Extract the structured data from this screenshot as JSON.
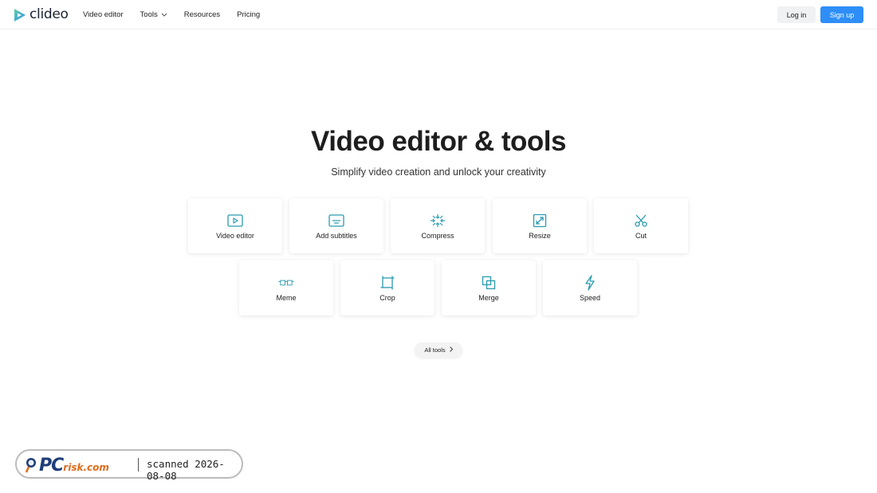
{
  "header": {
    "brand": "clideo",
    "nav": [
      {
        "label": "Video editor",
        "has_dropdown": false
      },
      {
        "label": "Tools",
        "has_dropdown": true
      },
      {
        "label": "Resources",
        "has_dropdown": false
      },
      {
        "label": "Pricing",
        "has_dropdown": false
      }
    ],
    "login_label": "Log in",
    "signup_label": "Sign up"
  },
  "hero": {
    "title": "Video editor & tools",
    "subtitle": "Simplify video creation and unlock your creativity"
  },
  "tools": [
    {
      "label": "Video editor",
      "icon": "play-icon"
    },
    {
      "label": "Add subtitles",
      "icon": "subtitles-icon"
    },
    {
      "label": "Compress",
      "icon": "compress-icon"
    },
    {
      "label": "Resize",
      "icon": "resize-icon"
    },
    {
      "label": "Cut",
      "icon": "scissors-icon"
    },
    {
      "label": "Meme",
      "icon": "meme-icon"
    },
    {
      "label": "Crop",
      "icon": "crop-icon"
    },
    {
      "label": "Merge",
      "icon": "merge-icon"
    },
    {
      "label": "Speed",
      "icon": "lightning-icon"
    }
  ],
  "all_tools_label": "All tools",
  "watermark": {
    "brand_pc": "PC",
    "brand_risk": "risk.com",
    "text": "scanned 2026-08-08"
  },
  "colors": {
    "accent": "#2e8ef7",
    "icon": "#2a9bb0",
    "logo_green": "#5fd1a0",
    "logo_blue": "#2e8ef7"
  }
}
